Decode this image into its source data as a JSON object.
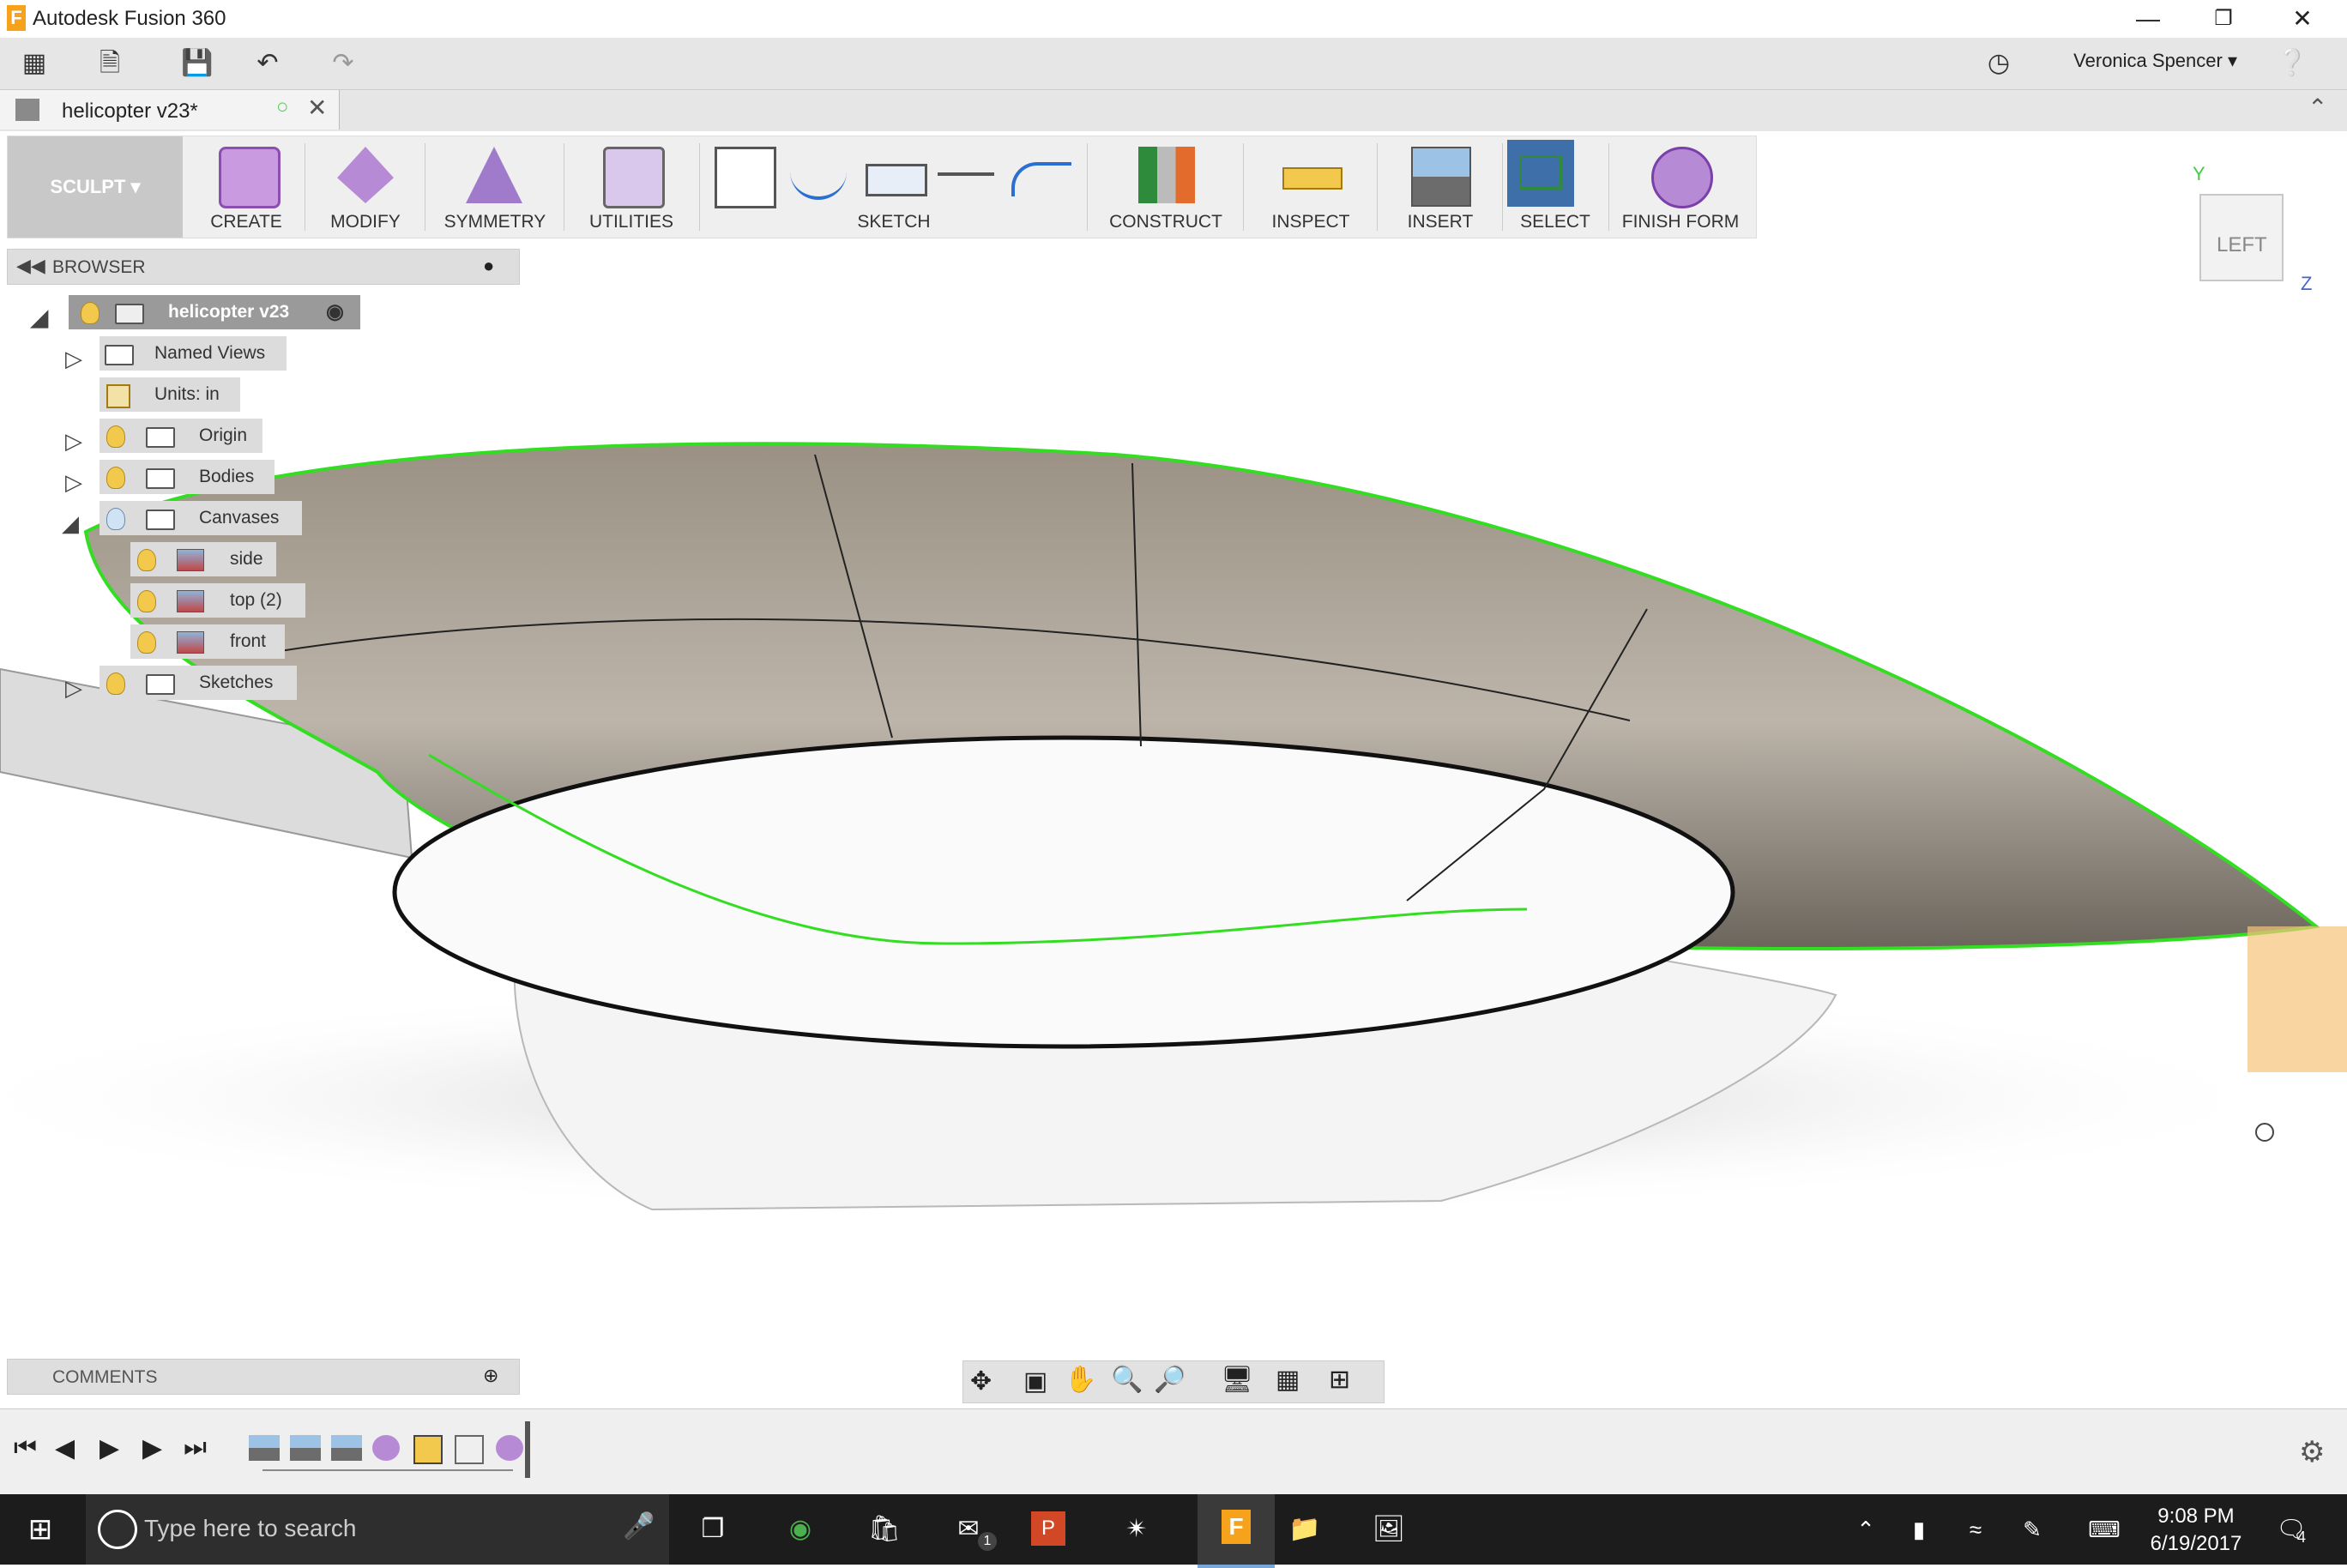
{
  "window": {
    "title": "Autodesk Fusion 360",
    "app_icon_letter": "F"
  },
  "quick_access": {
    "user_name": "Veronica Spencer"
  },
  "document_tab": {
    "name": "helicopter v23*"
  },
  "ribbon": {
    "workspace": "SCULPT",
    "groups": [
      {
        "label": "CREATE"
      },
      {
        "label": "MODIFY"
      },
      {
        "label": "SYMMETRY"
      },
      {
        "label": "UTILITIES"
      },
      {
        "label": "SKETCH"
      },
      {
        "label": "CONSTRUCT"
      },
      {
        "label": "INSPECT"
      },
      {
        "label": "INSERT"
      },
      {
        "label": "SELECT"
      },
      {
        "label": "FINISH FORM"
      }
    ]
  },
  "browser": {
    "header": "BROWSER",
    "root": "helicopter v23",
    "items": [
      "Named Views",
      "Units: in",
      "Origin",
      "Bodies",
      "Canvases",
      "side",
      "top (2)",
      "front",
      "Sketches"
    ]
  },
  "viewcube": {
    "face": "LEFT",
    "axis_y": "Y",
    "axis_z": "Z"
  },
  "comments": {
    "header": "COMMENTS"
  },
  "taskbar": {
    "search_placeholder": "Type here to search",
    "time": "9:08 PM",
    "date": "6/19/2017",
    "notification_count": "4",
    "mail_badge": "1"
  },
  "colors": {
    "accent_selection": "#33dd22",
    "select_active": "#3f6fa8",
    "surface": "#9a9184"
  }
}
